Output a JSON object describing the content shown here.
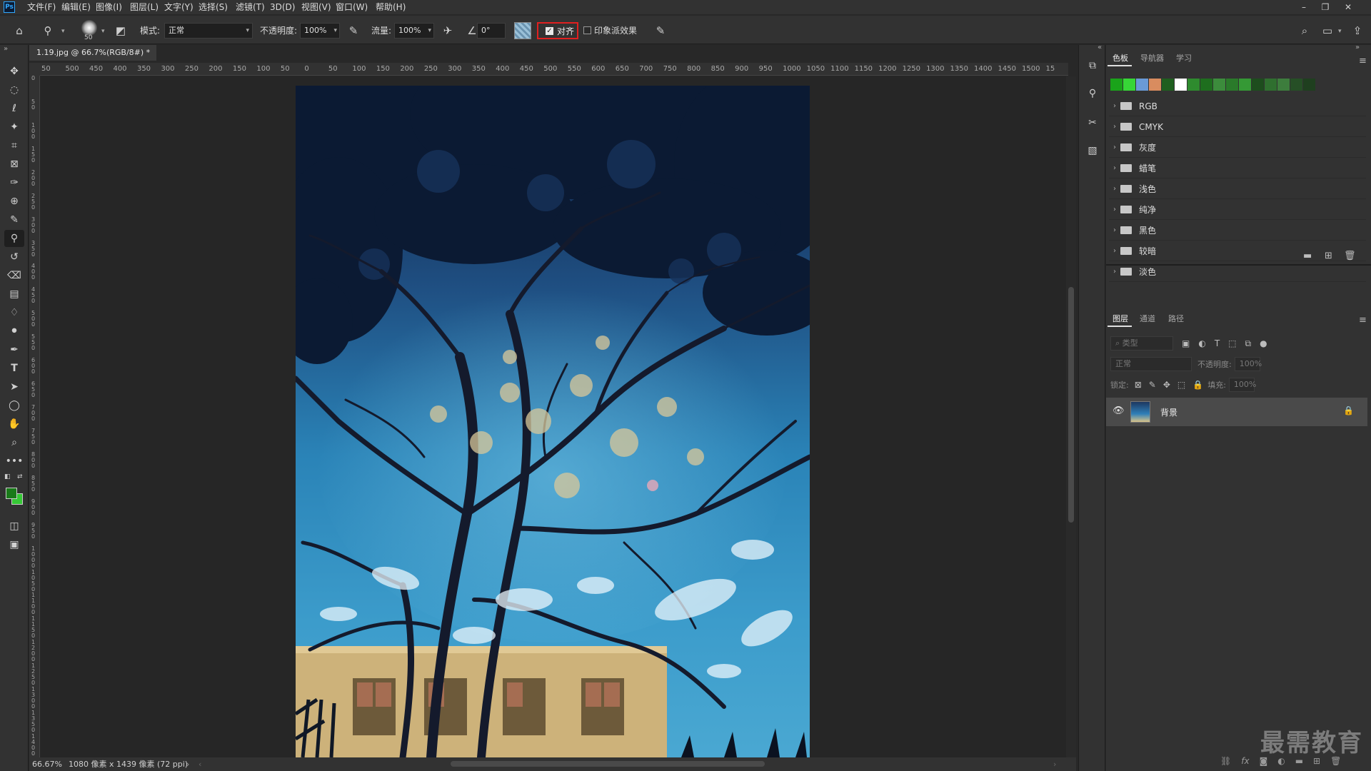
{
  "menubar": {
    "logo": "Ps",
    "items": [
      "文件(F)",
      "编辑(E)",
      "图像(I)",
      "图层(L)",
      "文字(Y)",
      "选择(S)",
      "滤镜(T)",
      "3D(D)",
      "视图(V)",
      "窗口(W)",
      "帮助(H)"
    ],
    "window_controls": [
      "–",
      "❐",
      "✕"
    ]
  },
  "options": {
    "brush_size": "50",
    "mode_label": "模式:",
    "mode_value": "正常",
    "opacity_label": "不透明度:",
    "opacity_value": "100%",
    "flow_label": "流量:",
    "flow_value": "100%",
    "angle_value": "0°",
    "align_label": "对齐",
    "align_checked": true,
    "impressionist_label": "印象派效果",
    "impressionist_checked": false
  },
  "document": {
    "tab_title": "1.19.jpg @ 66.7%(RGB/8#) *",
    "ruler_top_labels": [
      "50",
      "500",
      "450",
      "400",
      "350",
      "300",
      "250",
      "200",
      "150",
      "100",
      "50",
      "0",
      "50",
      "100",
      "150",
      "200",
      "250",
      "300",
      "350",
      "400",
      "450",
      "500",
      "550",
      "600",
      "650",
      "700",
      "750",
      "800",
      "850",
      "900",
      "950",
      "1000",
      "1050",
      "1100",
      "1150",
      "1200",
      "1250",
      "1300",
      "1350",
      "1400",
      "1450",
      "1500",
      "15"
    ],
    "ruler_left_labels": [
      "0",
      "5 0",
      "1 0 0",
      "1 5 0",
      "2 0 0",
      "2 5 0",
      "3 0 0",
      "3 5 0",
      "4 0 0",
      "4 5 0",
      "5 0 0",
      "5 5 0",
      "6 0 0",
      "6 5 0",
      "7 0 0",
      "7 5 0",
      "8 0 0",
      "8 5 0",
      "9 0 0",
      "9 5 0",
      "1 0 0 0",
      "1 0 5 0",
      "1 1 0 0",
      "1 1 5 0",
      "1 2 0 0",
      "1 2 5 0",
      "1 3 0 0",
      "1 3 5 0",
      "1 4 0 0"
    ]
  },
  "status": {
    "zoom": "66.67%",
    "doc_info": "1080 像素 x 1439 像素 (72 ppi)"
  },
  "swatches_panel": {
    "tabs": [
      "色板",
      "导航器",
      "学习"
    ],
    "active_tab": 0,
    "recent_colors": [
      "#1aa31a",
      "#37d637",
      "#6a9ad6",
      "#d98c5f",
      "#1f5f1f",
      "#ffffff",
      "#2e8b2e",
      "#1e6e1e",
      "#3c8c3c",
      "#2a7a2a",
      "#359935",
      "#1d4d1d",
      "#2f6f2f",
      "#3d7d3d",
      "#264f26",
      "#1f3f1f"
    ],
    "folders": [
      "RGB",
      "CMYK",
      "灰度",
      "蜡笔",
      "浅色",
      "纯净",
      "黑色",
      "较暗",
      "淡色"
    ]
  },
  "layers_panel": {
    "tabs": [
      "图层",
      "通道",
      "路径"
    ],
    "active_tab": 0,
    "filter_placeholder": "类型",
    "blend_mode": "正常",
    "opacity_label": "不透明度:",
    "opacity_value": "100%",
    "lock_label": "锁定:",
    "fill_label": "填充:",
    "fill_value": "100%",
    "layers": [
      {
        "name": "背景",
        "visible": true,
        "locked": true
      }
    ]
  },
  "colors": {
    "foreground": "#1a7a1a",
    "background": "#36c836",
    "highlight_red": "#e02020"
  },
  "watermark": "最需教育"
}
